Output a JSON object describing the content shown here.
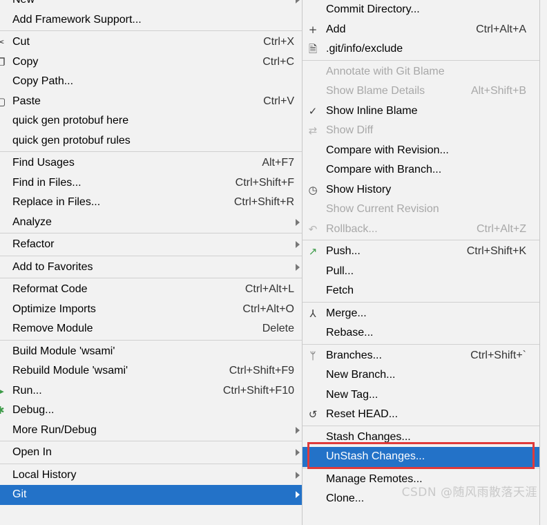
{
  "left_menu": {
    "new": "New",
    "add_framework": "Add Framework Support...",
    "cut": "Cut",
    "cut_sc": "Ctrl+X",
    "copy": "Copy",
    "copy_sc": "Ctrl+C",
    "copy_path": "Copy Path...",
    "paste": "Paste",
    "paste_sc": "Ctrl+V",
    "quick_here": "quick gen protobuf here",
    "quick_rules": "quick gen protobuf rules",
    "find_usages": "Find Usages",
    "find_usages_sc": "Alt+F7",
    "find_in_files": "Find in Files...",
    "find_in_files_sc": "Ctrl+Shift+F",
    "replace_in_files": "Replace in Files...",
    "replace_in_files_sc": "Ctrl+Shift+R",
    "analyze": "Analyze",
    "refactor": "Refactor",
    "add_to_favorites": "Add to Favorites",
    "reformat_code": "Reformat Code",
    "reformat_code_sc": "Ctrl+Alt+L",
    "optimize_imports": "Optimize Imports",
    "optimize_imports_sc": "Ctrl+Alt+O",
    "remove_module": "Remove Module",
    "remove_module_sc": "Delete",
    "build_module": "Build Module 'wsami'",
    "rebuild_module": "Rebuild Module 'wsami'",
    "rebuild_module_sc": "Ctrl+Shift+F9",
    "run": "Run...",
    "run_sc": "Ctrl+Shift+F10",
    "debug": "Debug...",
    "more_run_debug": "More Run/Debug",
    "open_in": "Open In",
    "local_history": "Local History",
    "git": "Git"
  },
  "git_menu": {
    "commit_directory": "Commit Directory...",
    "add": "Add",
    "add_sc": "Ctrl+Alt+A",
    "git_info_exclude": ".git/info/exclude",
    "annotate": "Annotate with Git Blame",
    "show_blame_details": "Show Blame Details",
    "show_blame_details_sc": "Alt+Shift+B",
    "show_inline_blame": "Show Inline Blame",
    "show_diff": "Show Diff",
    "compare_revision": "Compare with Revision...",
    "compare_branch": "Compare with Branch...",
    "show_history": "Show History",
    "show_current_revision": "Show Current Revision",
    "rollback": "Rollback...",
    "rollback_sc": "Ctrl+Alt+Z",
    "push": "Push...",
    "push_sc": "Ctrl+Shift+K",
    "pull": "Pull...",
    "fetch": "Fetch",
    "merge": "Merge...",
    "rebase": "Rebase...",
    "branches": "Branches...",
    "branches_sc": "Ctrl+Shift+`",
    "new_branch": "New Branch...",
    "new_tag": "New Tag...",
    "reset_head": "Reset HEAD...",
    "stash_changes": "Stash Changes...",
    "unstash_changes": "UnStash Changes...",
    "manage_remotes": "Manage Remotes...",
    "clone": "Clone..."
  },
  "watermark": "CSDN @随风雨散落天涯",
  "colors": {
    "selection": "#2372c8",
    "highlight_box": "#e03a3a",
    "background": "#f2f2f2"
  },
  "icons": {
    "cut": "scissors-icon",
    "copy": "copy-icon",
    "paste": "clipboard-icon",
    "run": "run-icon",
    "debug": "debug-icon",
    "add": "plus-icon",
    "exclude": "file-lock-icon",
    "inline_blame": "checkmark-icon",
    "diff": "diff-icon",
    "history": "clock-icon",
    "rollback": "undo-icon",
    "push": "push-arrow-icon",
    "merge": "merge-icon",
    "branches": "branch-icon",
    "reset_head": "reset-icon"
  }
}
